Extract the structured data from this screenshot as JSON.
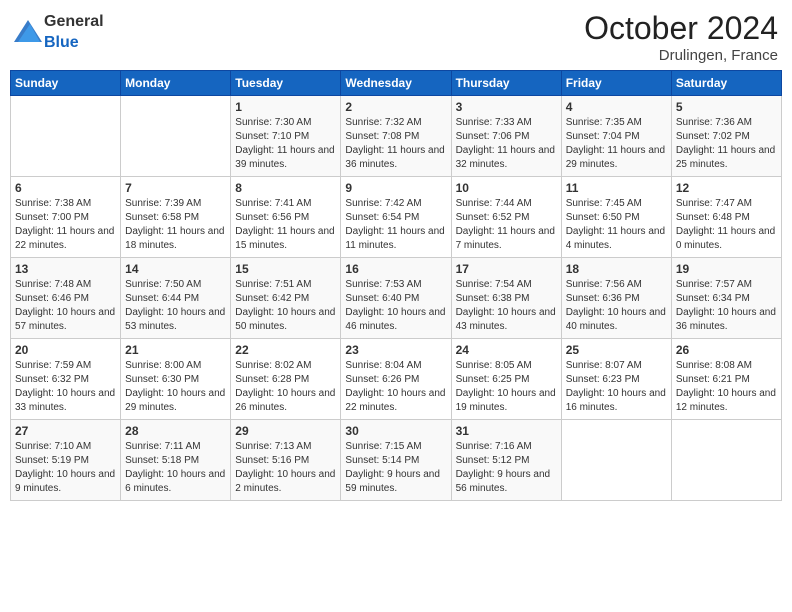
{
  "logo": {
    "general": "General",
    "blue": "Blue"
  },
  "header": {
    "month": "October 2024",
    "location": "Drulingen, France"
  },
  "days_of_week": [
    "Sunday",
    "Monday",
    "Tuesday",
    "Wednesday",
    "Thursday",
    "Friday",
    "Saturday"
  ],
  "weeks": [
    [
      {
        "day": "",
        "info": ""
      },
      {
        "day": "",
        "info": ""
      },
      {
        "day": "1",
        "info": "Sunrise: 7:30 AM\nSunset: 7:10 PM\nDaylight: 11 hours and 39 minutes."
      },
      {
        "day": "2",
        "info": "Sunrise: 7:32 AM\nSunset: 7:08 PM\nDaylight: 11 hours and 36 minutes."
      },
      {
        "day": "3",
        "info": "Sunrise: 7:33 AM\nSunset: 7:06 PM\nDaylight: 11 hours and 32 minutes."
      },
      {
        "day": "4",
        "info": "Sunrise: 7:35 AM\nSunset: 7:04 PM\nDaylight: 11 hours and 29 minutes."
      },
      {
        "day": "5",
        "info": "Sunrise: 7:36 AM\nSunset: 7:02 PM\nDaylight: 11 hours and 25 minutes."
      }
    ],
    [
      {
        "day": "6",
        "info": "Sunrise: 7:38 AM\nSunset: 7:00 PM\nDaylight: 11 hours and 22 minutes."
      },
      {
        "day": "7",
        "info": "Sunrise: 7:39 AM\nSunset: 6:58 PM\nDaylight: 11 hours and 18 minutes."
      },
      {
        "day": "8",
        "info": "Sunrise: 7:41 AM\nSunset: 6:56 PM\nDaylight: 11 hours and 15 minutes."
      },
      {
        "day": "9",
        "info": "Sunrise: 7:42 AM\nSunset: 6:54 PM\nDaylight: 11 hours and 11 minutes."
      },
      {
        "day": "10",
        "info": "Sunrise: 7:44 AM\nSunset: 6:52 PM\nDaylight: 11 hours and 7 minutes."
      },
      {
        "day": "11",
        "info": "Sunrise: 7:45 AM\nSunset: 6:50 PM\nDaylight: 11 hours and 4 minutes."
      },
      {
        "day": "12",
        "info": "Sunrise: 7:47 AM\nSunset: 6:48 PM\nDaylight: 11 hours and 0 minutes."
      }
    ],
    [
      {
        "day": "13",
        "info": "Sunrise: 7:48 AM\nSunset: 6:46 PM\nDaylight: 10 hours and 57 minutes."
      },
      {
        "day": "14",
        "info": "Sunrise: 7:50 AM\nSunset: 6:44 PM\nDaylight: 10 hours and 53 minutes."
      },
      {
        "day": "15",
        "info": "Sunrise: 7:51 AM\nSunset: 6:42 PM\nDaylight: 10 hours and 50 minutes."
      },
      {
        "day": "16",
        "info": "Sunrise: 7:53 AM\nSunset: 6:40 PM\nDaylight: 10 hours and 46 minutes."
      },
      {
        "day": "17",
        "info": "Sunrise: 7:54 AM\nSunset: 6:38 PM\nDaylight: 10 hours and 43 minutes."
      },
      {
        "day": "18",
        "info": "Sunrise: 7:56 AM\nSunset: 6:36 PM\nDaylight: 10 hours and 40 minutes."
      },
      {
        "day": "19",
        "info": "Sunrise: 7:57 AM\nSunset: 6:34 PM\nDaylight: 10 hours and 36 minutes."
      }
    ],
    [
      {
        "day": "20",
        "info": "Sunrise: 7:59 AM\nSunset: 6:32 PM\nDaylight: 10 hours and 33 minutes."
      },
      {
        "day": "21",
        "info": "Sunrise: 8:00 AM\nSunset: 6:30 PM\nDaylight: 10 hours and 29 minutes."
      },
      {
        "day": "22",
        "info": "Sunrise: 8:02 AM\nSunset: 6:28 PM\nDaylight: 10 hours and 26 minutes."
      },
      {
        "day": "23",
        "info": "Sunrise: 8:04 AM\nSunset: 6:26 PM\nDaylight: 10 hours and 22 minutes."
      },
      {
        "day": "24",
        "info": "Sunrise: 8:05 AM\nSunset: 6:25 PM\nDaylight: 10 hours and 19 minutes."
      },
      {
        "day": "25",
        "info": "Sunrise: 8:07 AM\nSunset: 6:23 PM\nDaylight: 10 hours and 16 minutes."
      },
      {
        "day": "26",
        "info": "Sunrise: 8:08 AM\nSunset: 6:21 PM\nDaylight: 10 hours and 12 minutes."
      }
    ],
    [
      {
        "day": "27",
        "info": "Sunrise: 7:10 AM\nSunset: 5:19 PM\nDaylight: 10 hours and 9 minutes."
      },
      {
        "day": "28",
        "info": "Sunrise: 7:11 AM\nSunset: 5:18 PM\nDaylight: 10 hours and 6 minutes."
      },
      {
        "day": "29",
        "info": "Sunrise: 7:13 AM\nSunset: 5:16 PM\nDaylight: 10 hours and 2 minutes."
      },
      {
        "day": "30",
        "info": "Sunrise: 7:15 AM\nSunset: 5:14 PM\nDaylight: 9 hours and 59 minutes."
      },
      {
        "day": "31",
        "info": "Sunrise: 7:16 AM\nSunset: 5:12 PM\nDaylight: 9 hours and 56 minutes."
      },
      {
        "day": "",
        "info": ""
      },
      {
        "day": "",
        "info": ""
      }
    ]
  ]
}
